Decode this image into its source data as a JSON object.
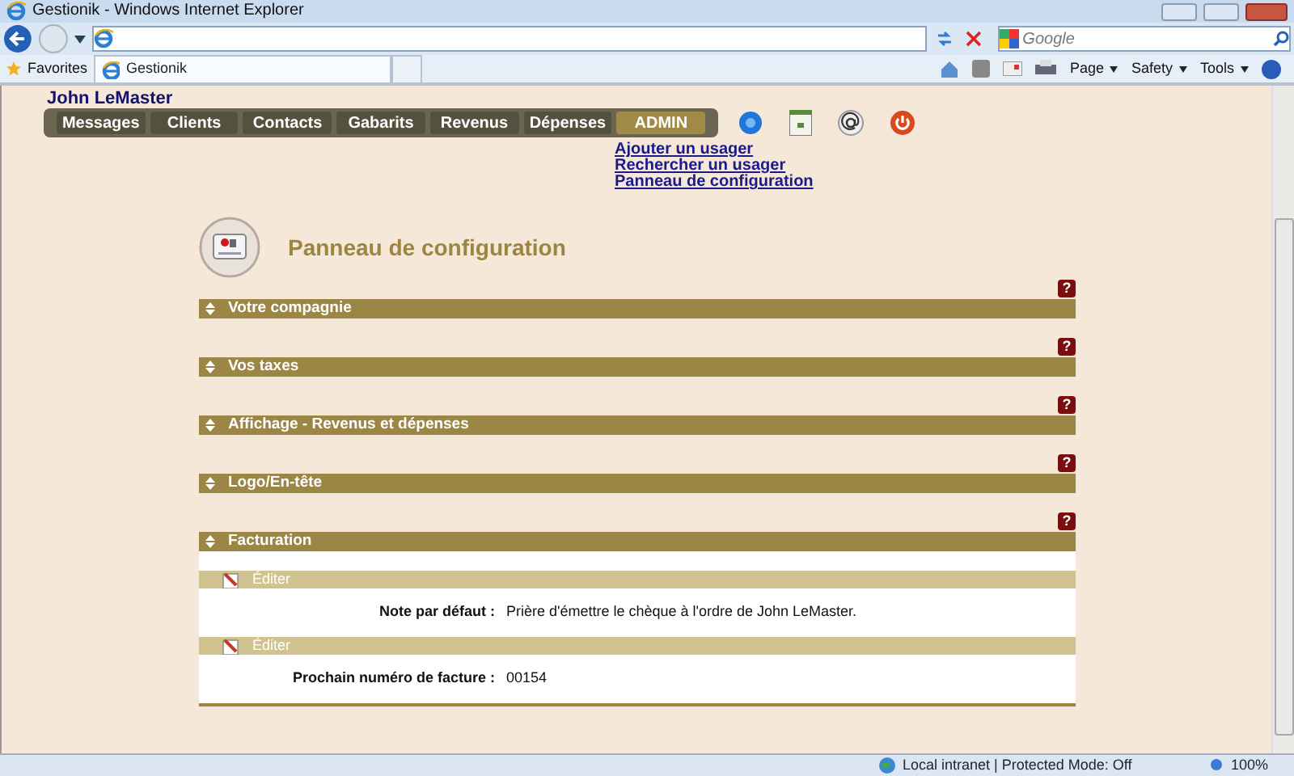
{
  "browser": {
    "title": "Gestionik - Windows Internet Explorer",
    "search_placeholder": "Google",
    "favorites": "Favorites",
    "tabs": [
      {
        "label": "Gestionik"
      }
    ],
    "commands": [
      "Page",
      "Safety",
      "Tools"
    ],
    "status": "Local intranet | Protected Mode: Off",
    "zoom": "100%"
  },
  "user": "John LeMaster",
  "nav": [
    {
      "label": "Messages",
      "selected": false
    },
    {
      "label": "Clients",
      "selected": false
    },
    {
      "label": "Contacts",
      "selected": false
    },
    {
      "label": "Gabarits",
      "selected": false
    },
    {
      "label": "Revenus",
      "selected": false
    },
    {
      "label": "Dépenses",
      "selected": false
    },
    {
      "label": "ADMIN",
      "selected": true
    }
  ],
  "admin_links": [
    "Ajouter un usager",
    "Rechercher un usager",
    "Panneau de configuration"
  ],
  "page_title": "Panneau de configuration",
  "sections": [
    {
      "title": "Votre compagnie",
      "help": "?"
    },
    {
      "title": "Vos taxes",
      "help": "?"
    },
    {
      "title": "Affichage - Revenus et dépenses",
      "help": "?"
    },
    {
      "title": "Logo/En-tête",
      "help": "?"
    },
    {
      "title": "Facturation",
      "help": "?",
      "rows": [
        {
          "action": "Éditer",
          "label": "Note par défaut :",
          "value": "Prière d'émettre le chèque à l'ordre de John LeMaster."
        },
        {
          "action": "Éditer",
          "label": "Prochain numéro de facture :",
          "value": "00154"
        }
      ]
    }
  ]
}
